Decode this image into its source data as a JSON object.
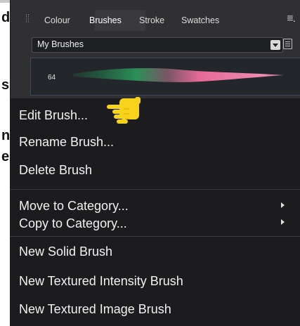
{
  "background": {
    "fragments": [
      "d",
      "s",
      "n",
      "e"
    ]
  },
  "panel": {
    "tabs": [
      {
        "label": "Colour",
        "active": false
      },
      {
        "label": "Brushes",
        "active": true
      },
      {
        "label": "Stroke",
        "active": false
      },
      {
        "label": "Swatches",
        "active": false
      }
    ],
    "category_dropdown": {
      "selected": "My Brushes"
    },
    "brush": {
      "size": "64"
    },
    "icons": {
      "menu": "hamburger-icon",
      "list": "list-view-icon",
      "dropdown": "chevron-down-icon"
    }
  },
  "context_menu": {
    "items": [
      {
        "label": "Edit Brush...",
        "submenu": false
      },
      {
        "label": "Rename Brush...",
        "submenu": false
      },
      {
        "label": "Delete Brush",
        "submenu": false
      },
      {
        "label": "Move to Category...",
        "submenu": true
      },
      {
        "label": "Copy to Category...",
        "submenu": true
      },
      {
        "label": "New Solid Brush",
        "submenu": false
      },
      {
        "label": "New Textured Intensity Brush",
        "submenu": false
      },
      {
        "label": "New Textured Image Brush",
        "submenu": false
      }
    ]
  },
  "overlay": {
    "icon": "pointing-hand-icon",
    "color": "#f7d31c"
  },
  "colors": {
    "panel_bg": "#303033",
    "menu_bg": "#1c1c1e",
    "accent_border": "#3e4a5c",
    "brush_pink": "#e56a96"
  }
}
